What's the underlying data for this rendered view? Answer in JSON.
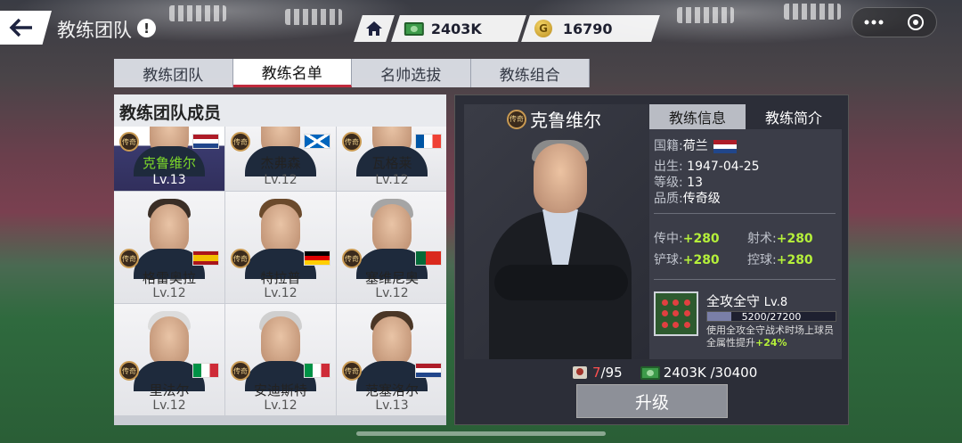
{
  "header": {
    "title": "教练团队",
    "info_icon": "!"
  },
  "resources": {
    "cash": "2403K",
    "coins": "16790",
    "coin_symbol": "G"
  },
  "tabs": [
    "教练团队",
    "教练名单",
    "名帅选拔",
    "教练组合"
  ],
  "active_tab": 1,
  "roster": {
    "heading": "教练团队成员",
    "badge": "传奇",
    "members": [
      {
        "name": "克鲁维尔",
        "level": "Lv.13",
        "flag": "netherlands",
        "selected": true
      },
      {
        "name": "杰弗森",
        "level": "Lv.12",
        "flag": "scotland"
      },
      {
        "name": "瓦格莱",
        "level": "Lv.12",
        "flag": "france"
      },
      {
        "name": "格雷奥拉",
        "level": "Lv.12",
        "flag": "spain"
      },
      {
        "name": "特拉普",
        "level": "Lv.12",
        "flag": "germany"
      },
      {
        "name": "塞维尼奥",
        "level": "Lv.12",
        "flag": "portugal"
      },
      {
        "name": "里法尔",
        "level": "Lv.12",
        "flag": "italy"
      },
      {
        "name": "安迪斯特",
        "level": "Lv.12",
        "flag": "italy"
      },
      {
        "name": "范塞洛尔",
        "level": "Lv.13",
        "flag": "netherlands"
      }
    ]
  },
  "detail": {
    "name": "克鲁维尔",
    "badge": "传奇",
    "tabs": [
      "教练信息",
      "教练简介"
    ],
    "nationality_label": "国籍:",
    "nationality": "荷兰",
    "birth_label": "出生:",
    "birth": "1947-04-25",
    "level_label": "等级:",
    "level": "13",
    "quality_label": "品质:",
    "quality": "传奇级",
    "stats": [
      {
        "label": "传中:",
        "value": "+280"
      },
      {
        "label": "射术:",
        "value": "+280"
      },
      {
        "label": "铲球:",
        "value": "+280"
      },
      {
        "label": "控球:",
        "value": "+280"
      }
    ],
    "skill": {
      "name": "全攻全守",
      "level": "Lv.8",
      "progress": "5200/27200",
      "progress_fraction": 0.19,
      "desc": "使用全攻全守战术时场上球员全属性提升",
      "bonus": "+24%"
    },
    "cost": {
      "cards": "7",
      "cards_total": "/95",
      "cash": "2403K /30400"
    },
    "upgrade_label": "升级"
  }
}
